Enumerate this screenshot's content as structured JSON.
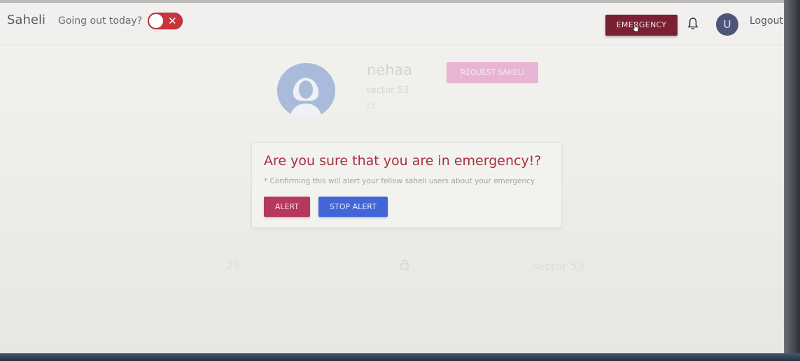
{
  "navbar": {
    "brand": "Saheli",
    "going_out_label": "Going out today?",
    "toggle_state": "off",
    "toggle_icon": "close-icon",
    "emergency_label": "EMERGENCY",
    "bell_icon": "bell-icon",
    "avatar_initial": "U",
    "logout_label": "Logout"
  },
  "profile": {
    "name": "nehaa",
    "sector": "sector 53",
    "age": "23",
    "request_label": "REQUEST SAHELI",
    "avatar_icon": "user-avatar-icon"
  },
  "background_row": {
    "age": "23",
    "icon": "lock-icon",
    "sector": "sector 53"
  },
  "modal": {
    "title": "Are you sure that you are in emergency!?",
    "note": "* Confirming this will alert your fellow saheli users about your emergency",
    "alert_label": "ALERT",
    "stop_alert_label": "STOP ALERT"
  },
  "colors": {
    "emergency": "#7b1f33",
    "alert": "#b5395f",
    "stop_alert": "#4366d6",
    "toggle": "#c9343c",
    "modal_title": "#a83040"
  }
}
